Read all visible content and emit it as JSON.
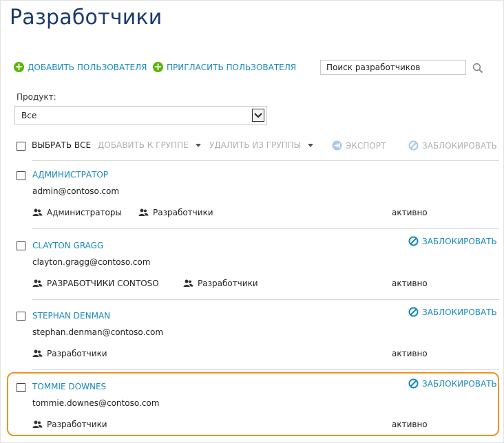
{
  "page": {
    "title": "Разработчики"
  },
  "actions": {
    "add_user": "ДОБАВИТЬ ПОЛЬЗОВАТЕЛЯ",
    "invite_user": "ПРИГЛАСИТЬ ПОЛЬЗОВАТЕЛЯ"
  },
  "search": {
    "placeholder": "Поиск разработчиков",
    "value": ""
  },
  "filter": {
    "product_label": "Продукт:",
    "product_value": "Все"
  },
  "toolbar": {
    "select_all": "ВЫБРАТЬ ВСЕ",
    "add_to_group": "ДОБАВИТЬ К ГРУППЕ",
    "remove_from_group": "УДАЛИТЬ ИЗ ГРУППЫ",
    "export": "ЭКСПОРТ",
    "block": "ЗАБЛОКИРОВАТЬ"
  },
  "users": [
    {
      "name": "АДМИНИСТРАТОР",
      "email": "admin@contoso.com",
      "groups": [
        "Администраторы",
        "Разработчики"
      ],
      "status": "активно",
      "action": ""
    },
    {
      "name": "CLAYTON GRAGG",
      "email": "clayton.gragg@contoso.com",
      "groups": [
        "РАЗРАБОТЧИКИ CONTOSO",
        "Разработчики"
      ],
      "status": "активно",
      "action": "ЗАБЛОКИРОВАТЬ"
    },
    {
      "name": "STEPHAN DENMAN",
      "email": "stephan.denman@contoso.com",
      "groups": [
        "Разработчики"
      ],
      "status": "активно",
      "action": "ЗАБЛОКИРОВАТЬ"
    },
    {
      "name": "TOMMIE DOWNES",
      "email": "tommie.downes@contoso.com",
      "groups": [
        "Разработчики"
      ],
      "status": "активно",
      "action": "ЗАБЛОКИРОВАТЬ"
    }
  ],
  "colors": {
    "accent": "#1789bd",
    "title": "#1a3a6b",
    "add_icon": "#5ab400",
    "highlight": "#f0921e",
    "disabled": "#b0b0b0"
  },
  "icons": {
    "add": "plus-circle-icon",
    "search": "magnifier-icon",
    "export": "export-arrow-icon",
    "block": "block-circle-icon",
    "group": "people-icon"
  }
}
